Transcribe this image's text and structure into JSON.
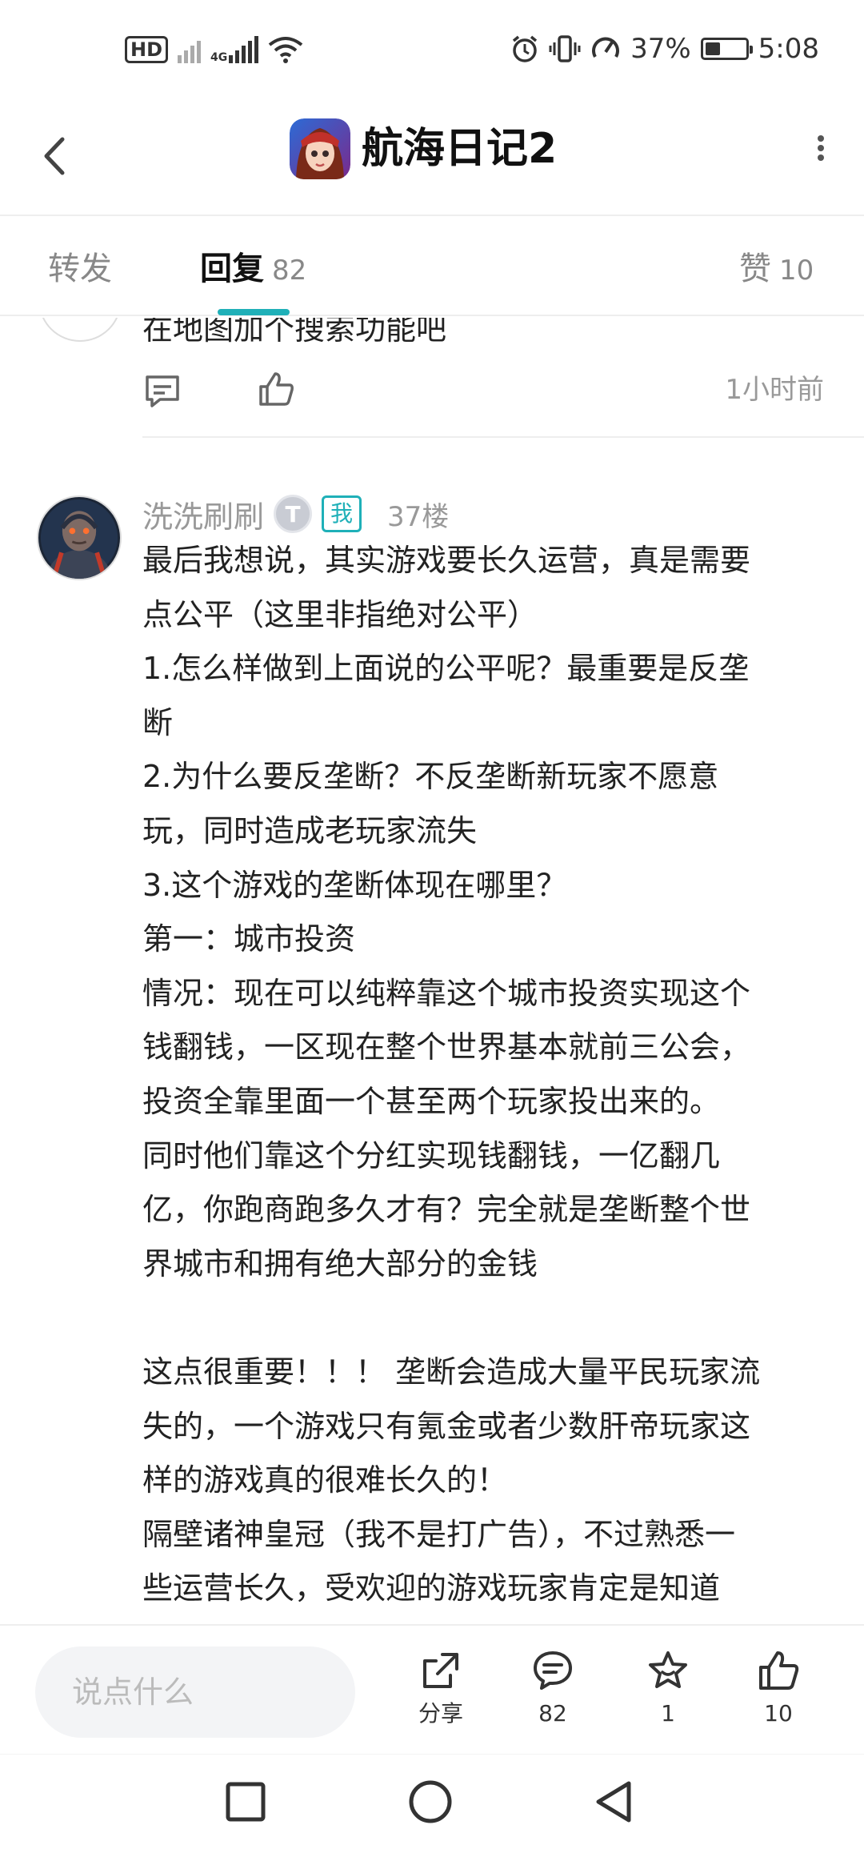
{
  "status_bar": {
    "hd": "HD",
    "net": "4G",
    "battery_percent": "37%",
    "battery_level": 0.37,
    "time": "5:08"
  },
  "title_bar": {
    "title": "航海日记2"
  },
  "tabs": [
    {
      "label": "转发",
      "count": ""
    },
    {
      "label": "回复",
      "count": "82"
    },
    {
      "label": "赞",
      "count": "10"
    }
  ],
  "previous_reply": {
    "text": "在地图加个搜索功能吧",
    "time": "1小时前"
  },
  "reply": {
    "username": "洗洗刷刷",
    "level": "T",
    "me_badge": "我",
    "floor": "37楼",
    "lines": [
      "最后我想说，其实游戏要长久运营，真是需要",
      "点公平（这里非指绝对公平）",
      "1.怎么样做到上面说的公平呢？最重要是反垄",
      "断",
      "2.为什么要反垄断？不反垄断新玩家不愿意",
      "玩，同时造成老玩家流失",
      "3.这个游戏的垄断体现在哪里？",
      "第一：城市投资",
      "情况：现在可以纯粹靠这个城市投资实现这个",
      "钱翻钱，一区现在整个世界基本就前三公会，",
      "投资全靠里面一个甚至两个玩家投出来的。",
      "同时他们靠这个分红实现钱翻钱，一亿翻几",
      "亿，你跑商跑多久才有？完全就是垄断整个世",
      "界城市和拥有绝大部分的金钱",
      "",
      "这点很重要！！！ 垄断会造成大量平民玩家流",
      "失的，一个游戏只有氪金或者少数肝帝玩家这",
      "样的游戏真的很难长久的！",
      "隔壁诸神皇冠（我不是打广告），不过熟悉一",
      "些运营长久，受欢迎的游戏玩家肯定是知道"
    ]
  },
  "bottom_bar": {
    "input_placeholder": "说点什么",
    "share_label": "分享",
    "comment_count": "82",
    "favorite_count": "1",
    "like_count": "10"
  },
  "colors": {
    "accent": "#1fb0b8",
    "muted": "#999999",
    "text": "#222222"
  },
  "icons": [
    "back-icon",
    "app-icon",
    "more-icon",
    "reply-icon",
    "like-icon",
    "share-icon",
    "comment-icon",
    "star-icon",
    "thumb-up-icon",
    "nav-square-icon",
    "nav-circle-icon",
    "nav-triangle-icon"
  ]
}
